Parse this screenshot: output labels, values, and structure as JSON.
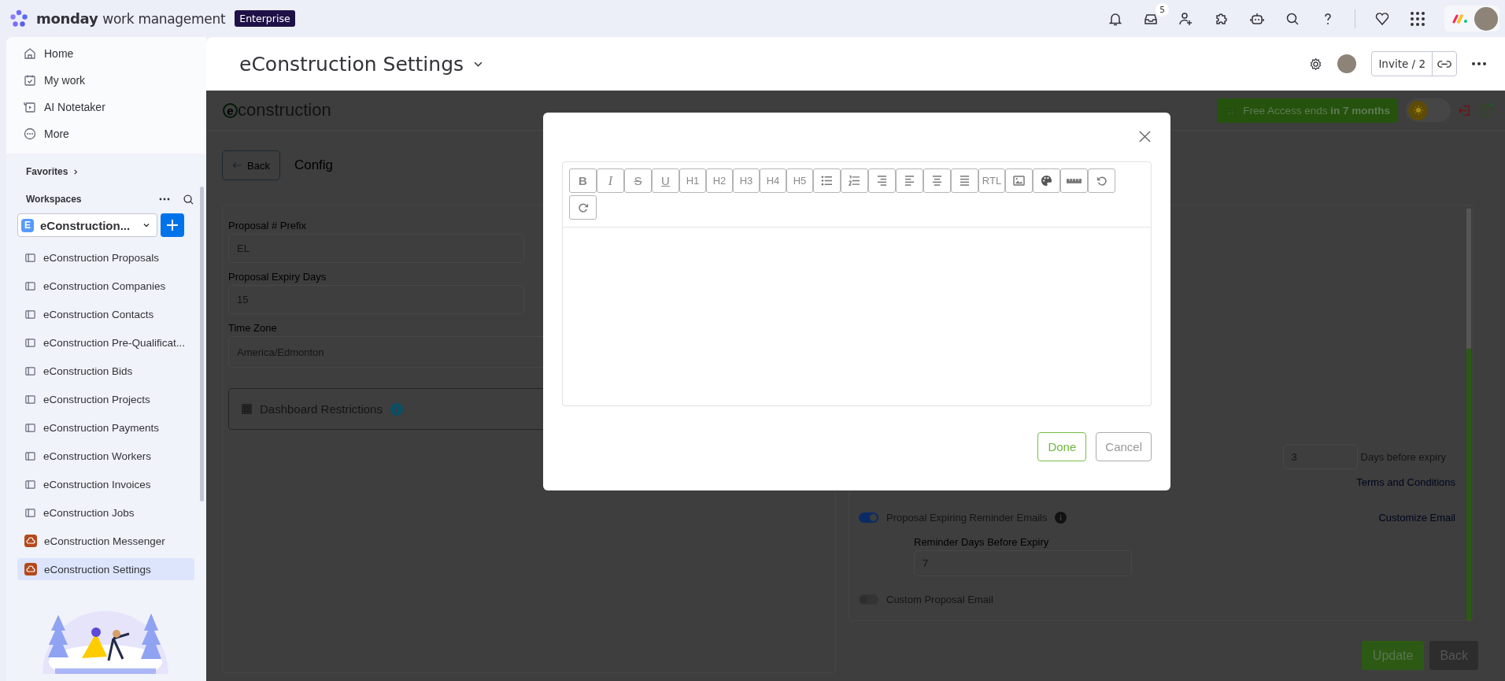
{
  "top_bar": {
    "brand": "monday",
    "product": "work management",
    "plan_badge": "Enterprise",
    "inbox_count": "5"
  },
  "sidebar": {
    "nav": [
      {
        "label": "Home",
        "kind": "home"
      },
      {
        "label": "My work",
        "kind": "calendar"
      },
      {
        "label": "AI Notetaker",
        "kind": "notetaker"
      },
      {
        "label": "More",
        "kind": "more"
      }
    ],
    "favorites": "Favorites",
    "workspaces": "Workspaces",
    "workspace": {
      "initial": "E",
      "name": "eConstruction..."
    },
    "items": [
      {
        "label": "eConstruction Proposals",
        "kind": "board",
        "selected": false
      },
      {
        "label": "eConstruction Companies",
        "kind": "board",
        "selected": false
      },
      {
        "label": "eConstruction Contacts",
        "kind": "board",
        "selected": false
      },
      {
        "label": "eConstruction Pre-Qualificat...",
        "kind": "board",
        "selected": false
      },
      {
        "label": "eConstruction Bids",
        "kind": "board",
        "selected": false
      },
      {
        "label": "eConstruction Projects",
        "kind": "board",
        "selected": false
      },
      {
        "label": "eConstruction Payments",
        "kind": "board",
        "selected": false
      },
      {
        "label": "eConstruction Workers",
        "kind": "board",
        "selected": false
      },
      {
        "label": "eConstruction Invoices",
        "kind": "board",
        "selected": false
      },
      {
        "label": "eConstruction Jobs",
        "kind": "board",
        "selected": false
      },
      {
        "label": "eConstruction Messenger",
        "kind": "app",
        "selected": false
      },
      {
        "label": "eConstruction Settings",
        "kind": "app",
        "selected": true
      }
    ]
  },
  "page": {
    "title": "eConstruction Settings",
    "invite": "Invite / 2"
  },
  "app": {
    "logo": {
      "mark": "e",
      "text": "construction"
    },
    "free_access": "Free Access ends **in 7 months**",
    "theme_toggle": {
      "on": false
    },
    "back": "Back",
    "heading": "Config",
    "fields": [
      {
        "label": "Proposal # Prefix",
        "value": "EL"
      },
      {
        "label": "Proposal Expiry Days",
        "value": "15"
      },
      {
        "label": "Time Zone",
        "value": "America/Edmonton"
      }
    ],
    "dashboard": "Dashboard Restrictions",
    "expiry_days": "3",
    "expiry_suffix": "Days before expiry",
    "terms_link": "Terms and Conditions",
    "reminder": {
      "label": "Proposal Expiring Reminder Emails",
      "on": true
    },
    "customize_link": "Customize Email",
    "reminder_days": {
      "label": "Reminder Days Before Expiry",
      "value": "7"
    },
    "custom_email": {
      "label": "Custom Proposal Email",
      "on": false
    },
    "update": "Update",
    "back_bottom": "Back"
  },
  "modal": {
    "toolbar": [
      {
        "kind": "bold",
        "label": "B"
      },
      {
        "kind": "italic",
        "label": "I"
      },
      {
        "kind": "strike",
        "label": "S"
      },
      {
        "kind": "underline",
        "label": "U"
      },
      {
        "kind": "text",
        "label": "H1"
      },
      {
        "kind": "text",
        "label": "H2"
      },
      {
        "kind": "text",
        "label": "H3"
      },
      {
        "kind": "text",
        "label": "H4"
      },
      {
        "kind": "text",
        "label": "H5"
      },
      {
        "kind": "bullets"
      },
      {
        "kind": "numbers"
      },
      {
        "kind": "align-right"
      },
      {
        "kind": "align-left"
      },
      {
        "kind": "align-center"
      },
      {
        "kind": "justify"
      },
      {
        "kind": "text",
        "label": "RTL"
      },
      {
        "kind": "image"
      },
      {
        "kind": "palette"
      },
      {
        "kind": "ruler"
      },
      {
        "kind": "undo"
      },
      {
        "kind": "redo"
      }
    ],
    "done": "Done",
    "cancel": "Cancel"
  }
}
